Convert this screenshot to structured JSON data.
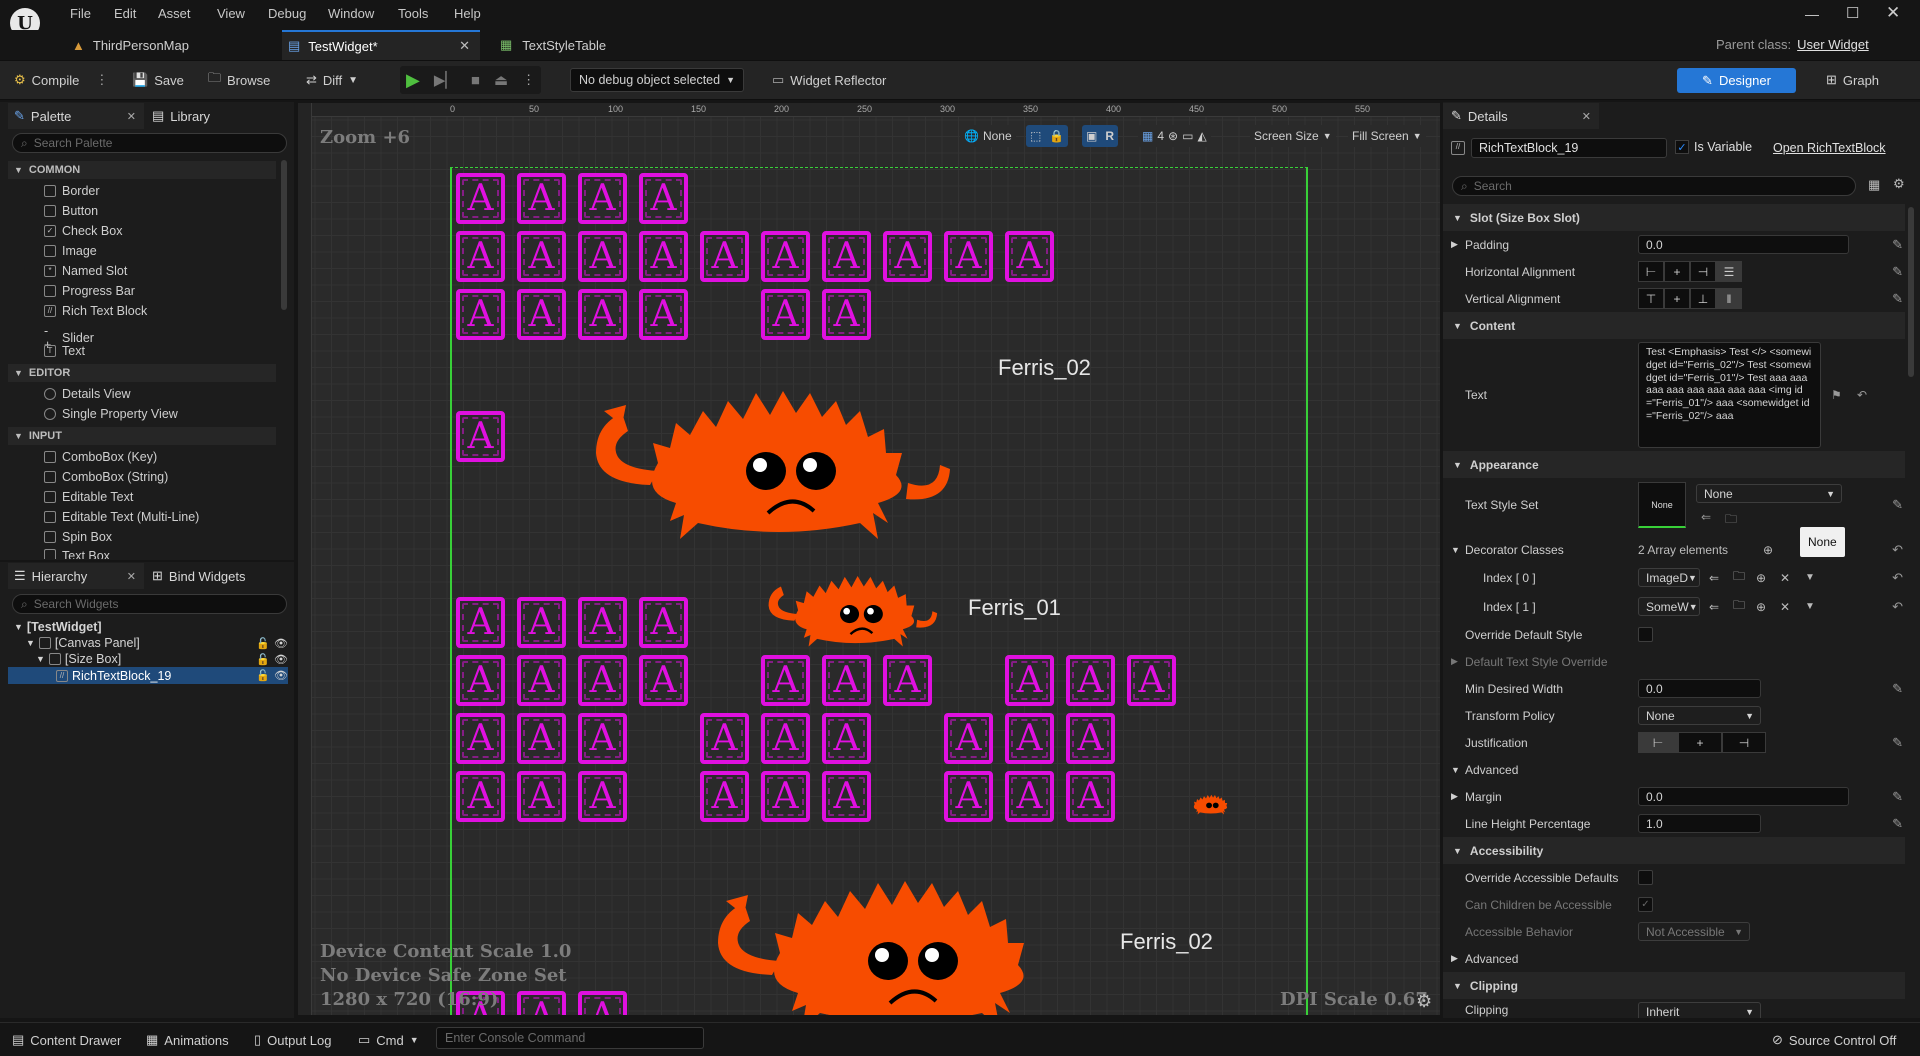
{
  "menu": [
    "File",
    "Edit",
    "Asset",
    "View",
    "Debug",
    "Window",
    "Tools",
    "Help"
  ],
  "tabs": [
    {
      "label": "ThirdPersonMap"
    },
    {
      "label": "TestWidget*"
    },
    {
      "label": "TextStyleTable"
    }
  ],
  "parent_class": {
    "label": "Parent class:",
    "value": "User Widget"
  },
  "toolbar": {
    "compile": "Compile",
    "save": "Save",
    "browse": "Browse",
    "diff": "Diff",
    "debug_object": "No debug object selected",
    "reflector": "Widget Reflector",
    "designer": "Designer",
    "graph": "Graph"
  },
  "palette": {
    "tab": "Palette",
    "library_tab": "Library",
    "search_placeholder": "Search Palette",
    "categories": [
      {
        "name": "COMMON",
        "items": [
          "Border",
          "Button",
          "Check Box",
          "Image",
          "Named Slot",
          "Progress Bar",
          "Rich Text Block",
          "Slider",
          "Text"
        ]
      },
      {
        "name": "EDITOR",
        "items": [
          "Details View",
          "Single Property View"
        ]
      },
      {
        "name": "INPUT",
        "items": [
          "ComboBox (Key)",
          "ComboBox (String)",
          "Editable Text",
          "Editable Text (Multi-Line)",
          "Spin Box",
          "Text Box"
        ]
      }
    ]
  },
  "hierarchy": {
    "tab": "Hierarchy",
    "bind_tab": "Bind Widgets",
    "search_placeholder": "Search Widgets",
    "items": [
      "[TestWidget]",
      "[Canvas Panel]",
      "[Size Box]",
      "RichTextBlock_19"
    ]
  },
  "viewport": {
    "zoom": "Zoom +6",
    "none_label": "None",
    "r_label": "R",
    "grid_count": "4",
    "screen_size": "Screen Size",
    "fill_screen": "Fill Screen",
    "ruler_ticks": [
      "0",
      "50",
      "100",
      "150",
      "200",
      "250",
      "300",
      "350",
      "400",
      "450",
      "500",
      "550"
    ],
    "device_scale": "Device Content Scale 1.0",
    "safe_zone": "No Device Safe Zone Set",
    "resolution": "1280 x 720 (16:9)",
    "dpi": "DPI Scale 0.67",
    "tile_letter": "A",
    "crab_labels": [
      "Ferris_02",
      "Ferris_01",
      "Ferris_02"
    ],
    "crab_color": "#f74c00",
    "tile_color": "#e010e0"
  },
  "details": {
    "tab": "Details",
    "name": "RichTextBlock_19",
    "is_variable": "Is Variable",
    "open_link": "Open RichTextBlock",
    "search_placeholder": "Search",
    "sections": {
      "slot": "Slot (Size Box Slot)",
      "content": "Content",
      "appearance": "Appearance",
      "advanced": "Advanced",
      "accessibility": "Accessibility",
      "advanced2": "Advanced",
      "clipping": "Clipping"
    },
    "padding_label": "Padding",
    "padding_value": "0.0",
    "halign_label": "Horizontal Alignment",
    "valign_label": "Vertical Alignment",
    "text_label": "Text",
    "text_value": "Test <Emphasis> Test </> <somewidget id=\"Ferris_02\"/> Test <somewidget id=\"Ferris_01\"/> Test aaa aaa aaa aaa aaa aaa aaa aaa <img id=\"Ferris_01\"/> aaa <somewidget id=\"Ferris_02\"/> aaa",
    "text_style_label": "Text Style Set",
    "text_style_thumb": "None",
    "text_style_value": "None",
    "tooltip": "None",
    "decorator_label": "Decorator Classes",
    "decorator_count": "2 Array elements",
    "index0_label": "Index [ 0 ]",
    "index0_value": "ImageD",
    "index1_label": "Index [ 1 ]",
    "index1_value": "SomeW",
    "override_style_label": "Override Default Style",
    "default_override_label": "Default Text Style Override",
    "min_width_label": "Min Desired Width",
    "min_width_value": "0.0",
    "transform_label": "Transform Policy",
    "transform_value": "None",
    "justification_label": "Justification",
    "margin_label": "Margin",
    "margin_value": "0.0",
    "line_height_label": "Line Height Percentage",
    "line_height_value": "1.0",
    "override_access_label": "Override Accessible Defaults",
    "children_access_label": "Can Children be Accessible",
    "access_behavior_label": "Accessible Behavior",
    "access_behavior_value": "Not Accessible",
    "clipping_label": "Clipping",
    "clipping_value": "Inherit"
  },
  "statusbar": {
    "content_drawer": "Content Drawer",
    "animations": "Animations",
    "output_log": "Output Log",
    "cmd": "Cmd",
    "console_placeholder": "Enter Console Command",
    "source_control": "Source Control Off"
  },
  "accent": "#2577d6"
}
